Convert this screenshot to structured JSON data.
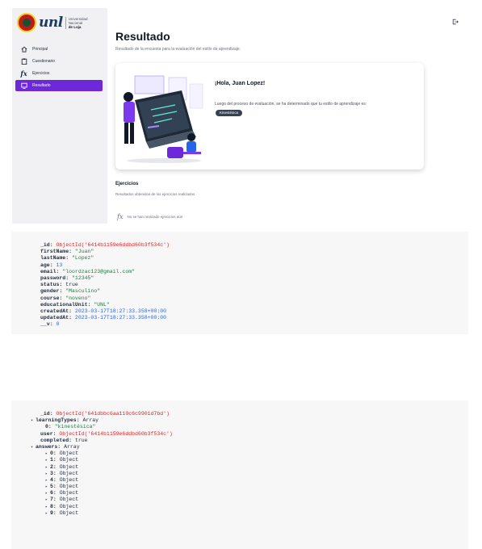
{
  "sidebar": {
    "logo_word": "unl",
    "logo_lines": [
      "Universidad",
      "Nacional",
      "de Loja"
    ],
    "items": [
      {
        "label": "Principal",
        "icon": "home-icon",
        "active": false
      },
      {
        "label": "Cuestionario",
        "icon": "clipboard-icon",
        "active": false
      },
      {
        "label": "Ejercicios",
        "icon": "fx-icon",
        "active": false
      },
      {
        "label": "Resultado",
        "icon": "monitor-icon",
        "active": true
      }
    ]
  },
  "header": {
    "logout_icon": "logout-icon"
  },
  "main": {
    "title": "Resultado",
    "subtitle": "Resultado de la encuesta para la evaluación del estilo de aprendizaje.",
    "card": {
      "greeting": "¡Hola, Juan Lopez!",
      "message": "Luego del proceso de evaluación, se ha determinado que tu estilo de aprendizaje es:",
      "style_chip": "Kinestésica"
    },
    "exercises": {
      "title": "Ejercicios",
      "subtitle": "Resultados obtenidos de los ejercicios realizados",
      "empty": "No se han realizado ejercicios aún"
    }
  },
  "doc1": [
    {
      "key": "_id: ",
      "val": "ObjectId('6414b1159e6ddbd60b3f534c')",
      "cls": "oid"
    },
    {
      "key": "firstName: ",
      "val": "\"Juan\"",
      "cls": "str"
    },
    {
      "key": "lastName: ",
      "val": "\"Lopez\"",
      "cls": "str"
    },
    {
      "key": "age: ",
      "val": "13",
      "cls": "num"
    },
    {
      "key": "email: ",
      "val": "\"loordzac123@gmail.com\"",
      "cls": "str"
    },
    {
      "key": "password: ",
      "val": "\"12345\"",
      "cls": "str"
    },
    {
      "key": "status: ",
      "val": "true",
      "cls": "plain"
    },
    {
      "key": "gender: ",
      "val": "\"Masculino\"",
      "cls": "str"
    },
    {
      "key": "course: ",
      "val": "\"noveno\"",
      "cls": "str"
    },
    {
      "key": "educationalUnit: ",
      "val": "\"UNL\"",
      "cls": "str"
    },
    {
      "key": "createdAt: ",
      "val": "2023-03-17T18:27:33.358+00:00",
      "cls": "num"
    },
    {
      "key": "updatedAt: ",
      "val": "2023-03-17T18:27:33.358+00:00",
      "cls": "num"
    },
    {
      "key": "__v: ",
      "val": "0",
      "cls": "num"
    }
  ],
  "doc2": [
    {
      "key": "_id: ",
      "val": "ObjectId('641dbbc6aa110c6c9901d7bd')",
      "cls": "oid",
      "indent": 0,
      "tri": ""
    },
    {
      "key": "learningTypes: ",
      "val": "Array",
      "cls": "plain",
      "indent": -1,
      "tri": "▾"
    },
    {
      "key": "0: ",
      "val": "\"kinestésica\"",
      "cls": "str",
      "indent": 1,
      "tri": ""
    },
    {
      "key": "user: ",
      "val": "ObjectId('6414b1159e6ddbd60b3f534c')",
      "cls": "oid",
      "indent": 0,
      "tri": ""
    },
    {
      "key": "completed: ",
      "val": "true",
      "cls": "plain",
      "indent": 0,
      "tri": ""
    },
    {
      "key": "answers: ",
      "val": "Array",
      "cls": "plain",
      "indent": -1,
      "tri": "▾"
    },
    {
      "key": "0: ",
      "val": "Object",
      "cls": "plain",
      "indent": 1,
      "tri": "▸"
    },
    {
      "key": "1: ",
      "val": "Object",
      "cls": "plain",
      "indent": 1,
      "tri": "▸"
    },
    {
      "key": "2: ",
      "val": "Object",
      "cls": "plain",
      "indent": 1,
      "tri": "▸"
    },
    {
      "key": "3: ",
      "val": "Object",
      "cls": "plain",
      "indent": 1,
      "tri": "▸"
    },
    {
      "key": "4: ",
      "val": "Object",
      "cls": "plain",
      "indent": 1,
      "tri": "▸"
    },
    {
      "key": "5: ",
      "val": "Object",
      "cls": "plain",
      "indent": 1,
      "tri": "▸"
    },
    {
      "key": "6: ",
      "val": "Object",
      "cls": "plain",
      "indent": 1,
      "tri": "▸"
    },
    {
      "key": "7: ",
      "val": "Object",
      "cls": "plain",
      "indent": 1,
      "tri": "▸"
    },
    {
      "key": "8: ",
      "val": "Object",
      "cls": "plain",
      "indent": 1,
      "tri": "▸"
    },
    {
      "key": "9: ",
      "val": "Object",
      "cls": "plain",
      "indent": 1,
      "tri": "▸"
    }
  ],
  "colors": {
    "accent": "#6d28d9",
    "oid": "#dc2626",
    "string": "#15803d",
    "number": "#2563eb"
  }
}
